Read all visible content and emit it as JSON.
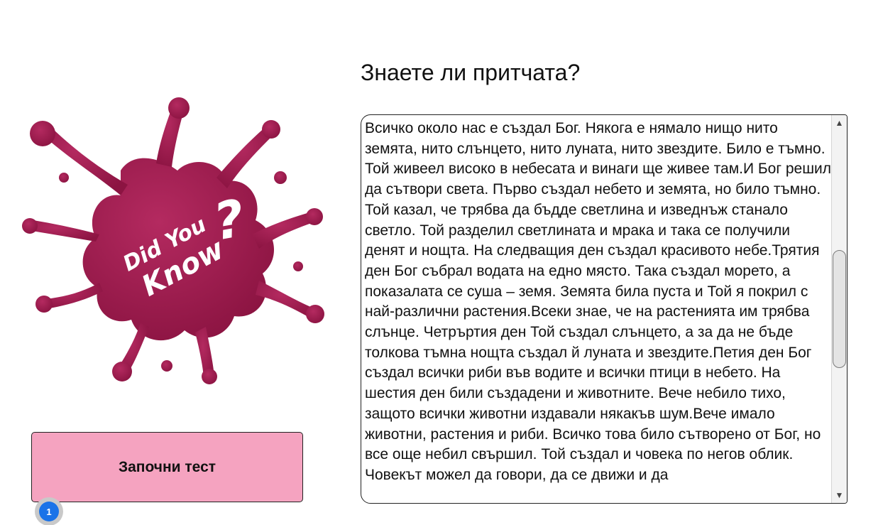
{
  "header": {
    "title": "Знаете ли притчата?"
  },
  "illustration": {
    "line1": "Did You",
    "line2": "Know",
    "mark": "?",
    "color": "#9c1a4b"
  },
  "actions": {
    "start_label": "Започни тест",
    "badge_count": "1"
  },
  "story": {
    "text": "Всичко около нас е създал Бог. Някога е нямало нищо  нито земята, нито слънцето, нито луната, нито звездите. Било е тъмно.  Той живеел високо в небесата и винаги ще живее там.И Бог решил да сътвори света.  Първо създал небето и земята, но било тъмно. Той казал, че трябва да  бъдде светлина и изведнъж станало светло. Той разделил светлината и  мрака и така се получили денят и нощта. На следващия ден създал  красивото небе.Трятия ден Бог събрал водата на  едно място. Така създал морето, а показалата се суша – земя. Земята била  пуста и Той я покрил с най-различни растения.Всеки знае, че на растенията им  трябва слънце. Четръртия ден Той създал слънцето, а за да не бъде  толкова тъмна нощта създал й луната и звездите.Петия ден Бог създал всички риби  във водите и всички птици в небето. На шестия ден били създадени и  животните. Вече небило тихо, защото всички животни издавали някакъв шум.Вече имало животни, растения и  риби. Всичко това било сътворено от Бог, но все още небил свършил. Той  създал и човека по негов облик. Човекът можел да говори, да се движи и  да"
  },
  "scrollbar": {
    "up_icon": "▲",
    "down_icon": "▼"
  }
}
